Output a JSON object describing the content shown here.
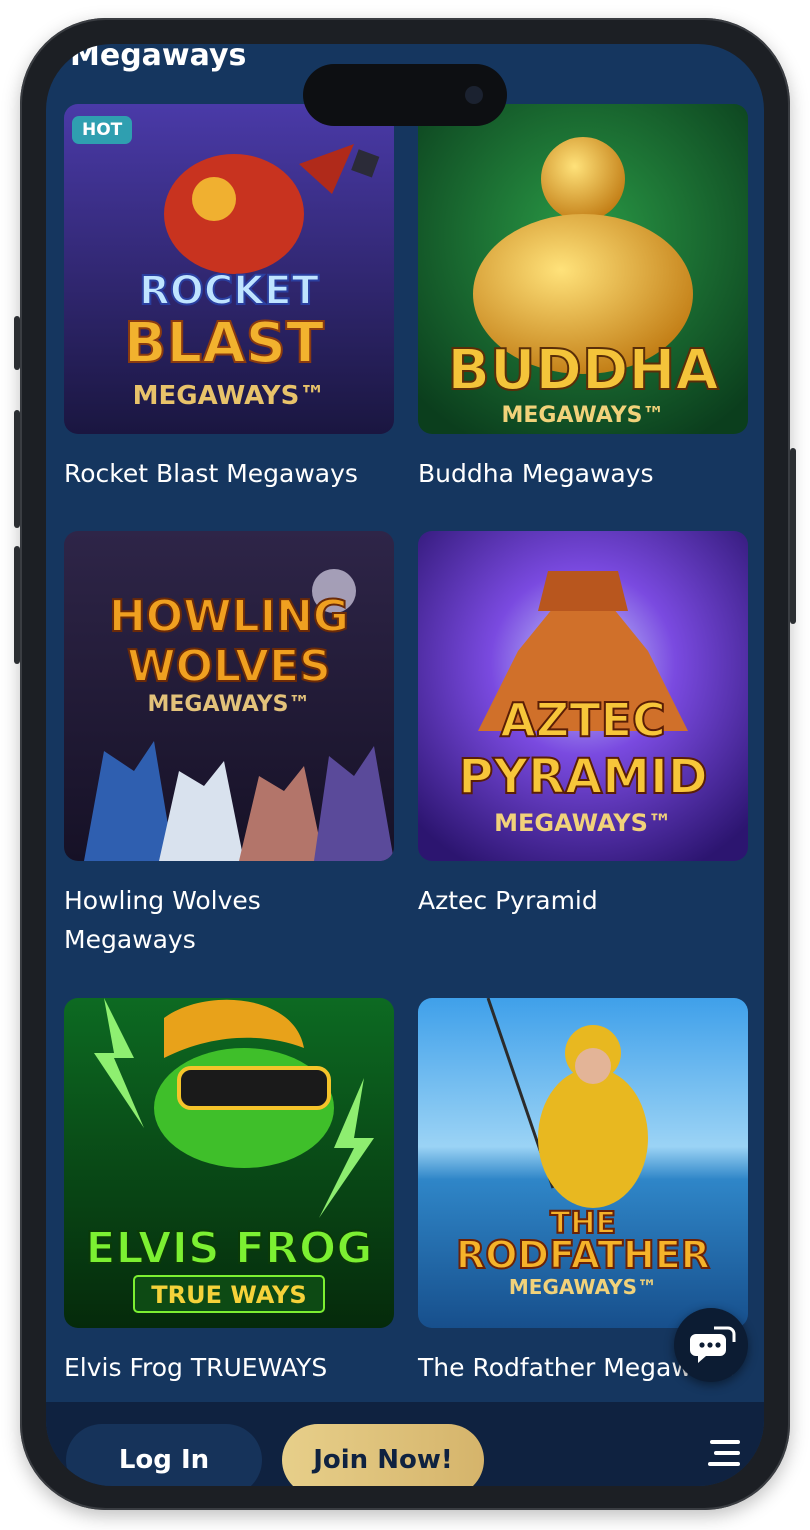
{
  "section": {
    "title": "Megaways"
  },
  "games": [
    {
      "name": "Rocket Blast Megaways",
      "badge": "HOT",
      "art": {
        "line1": "ROCKET",
        "line2": "BLAST",
        "sub": "MEGAWAYS™",
        "bg_top": "#3a2f8f",
        "bg_bottom": "#1e1a48"
      }
    },
    {
      "name": "Buddha Megaways",
      "badge": "",
      "art": {
        "line1": "BUDDHA",
        "line2": "",
        "sub": "MEGAWAYS™",
        "bg_top": "#1f7a3a",
        "bg_bottom": "#0d4a24"
      }
    },
    {
      "name": "Howling Wolves Megaways",
      "badge": "",
      "art": {
        "line1": "HOWLING",
        "line2": "WOLVES",
        "sub": "MEGAWAYS™",
        "bg_top": "#2a2143",
        "bg_bottom": "#1b1530"
      }
    },
    {
      "name": "Aztec Pyramid",
      "badge": "",
      "art": {
        "line1": "AZTEC",
        "line2": "PYRAMID",
        "sub": "MEGAWAYS™",
        "bg_top": "#6a3bd8",
        "bg_bottom": "#3b1f8a"
      }
    },
    {
      "name": "Elvis Frog TRUEWAYS",
      "badge": "",
      "art": {
        "line1": "ELVIS FROG",
        "line2": "TRUE WAYS",
        "sub": "",
        "bg_top": "#0f5a1a",
        "bg_bottom": "#062d0c"
      }
    },
    {
      "name": "The Rodfather Megaways",
      "badge": "",
      "art": {
        "line1": "THE",
        "line2": "RODFATHER",
        "sub": "MEGAWAYS™",
        "bg_top": "#3b9be0",
        "bg_bottom": "#1d5b9c"
      }
    }
  ],
  "footer": {
    "login_label": "Log In",
    "join_label": "Join Now!"
  },
  "icons": {
    "chat": "chat-bubble-icon",
    "menu": "hamburger-menu-icon"
  },
  "colors": {
    "background": "#15365f",
    "footer": "#0f2240",
    "join_button": "#e0c27c",
    "hot_badge": "#2f9fb0"
  }
}
